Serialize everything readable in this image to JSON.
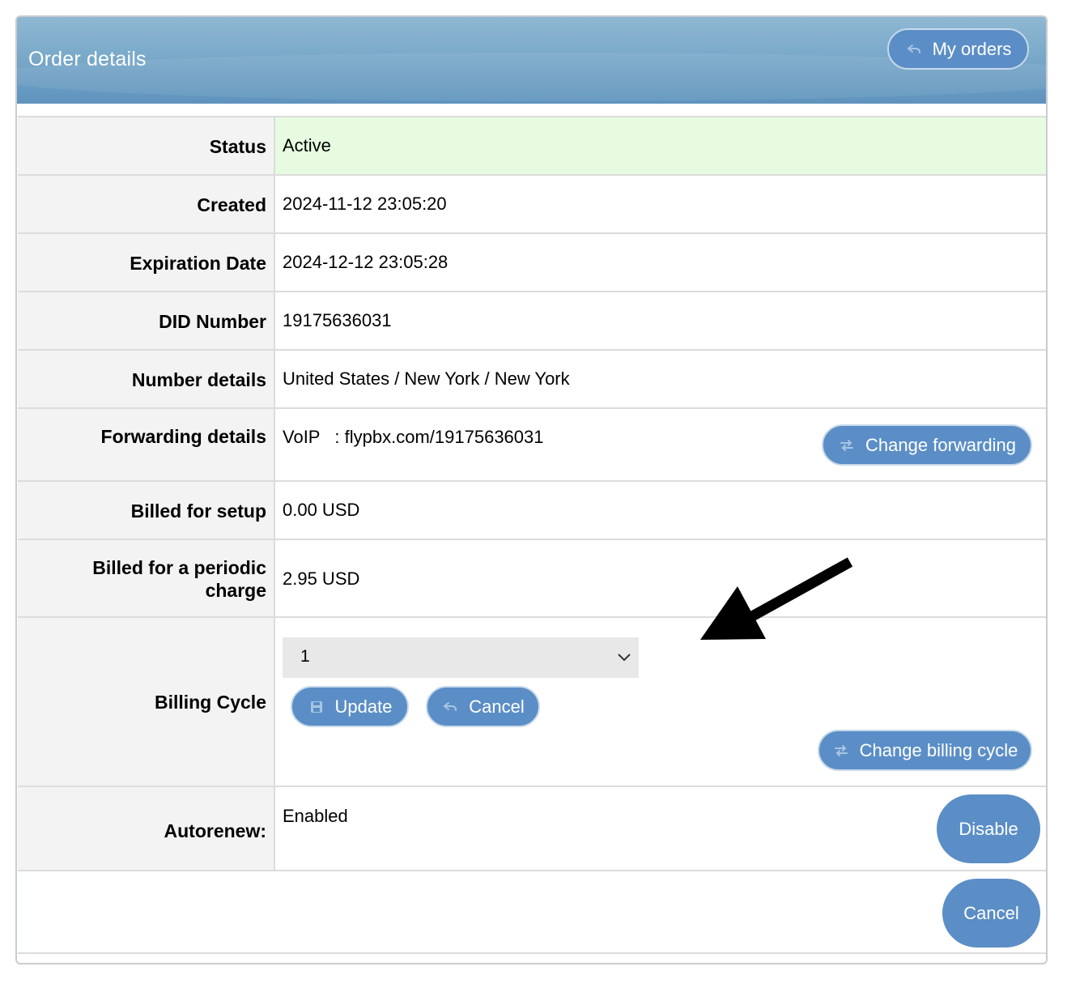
{
  "header": {
    "title": "Order details",
    "my_orders_label": "My orders"
  },
  "rows": {
    "status": {
      "label": "Status",
      "value": "Active",
      "highlight_color": "#e6fbe0"
    },
    "created": {
      "label": "Created",
      "value": "2024-11-12 23:05:20"
    },
    "expiration": {
      "label": "Expiration Date",
      "value": "2024-12-12 23:05:28"
    },
    "did": {
      "label": "DID Number",
      "value": "19175636031"
    },
    "number_details": {
      "label": "Number details",
      "value": "United States / New York / New York"
    },
    "forwarding": {
      "label": "Forwarding details",
      "value": "VoIP   : flypbx.com/19175636031",
      "button": "Change forwarding"
    },
    "billed_setup": {
      "label": "Billed for setup",
      "value": "0.00 USD"
    },
    "billed_periodic": {
      "label_line1": "Billed for a periodic",
      "label_line2": "charge",
      "value": "2.95 USD"
    },
    "billing_cycle": {
      "label": "Billing Cycle",
      "selected": "1",
      "update_label": "Update",
      "cancel_label": "Cancel",
      "change_label": "Change billing cycle"
    },
    "autorenew": {
      "label": "Autorenew:",
      "value": "Enabled",
      "disable_label": "Disable"
    }
  },
  "footer": {
    "cancel_label": "Cancel"
  },
  "colors": {
    "button": "#5b8ec6",
    "header": "#6a9cc4",
    "label_bg": "#f3f3f3"
  },
  "icons": {
    "my_orders": "return-arrow-icon",
    "change_forwarding": "swap-arrows-icon",
    "update": "save-disk-icon",
    "cancel": "return-arrow-icon",
    "change_billing": "swap-arrows-icon",
    "annotation": "arrow-pointer-icon"
  }
}
